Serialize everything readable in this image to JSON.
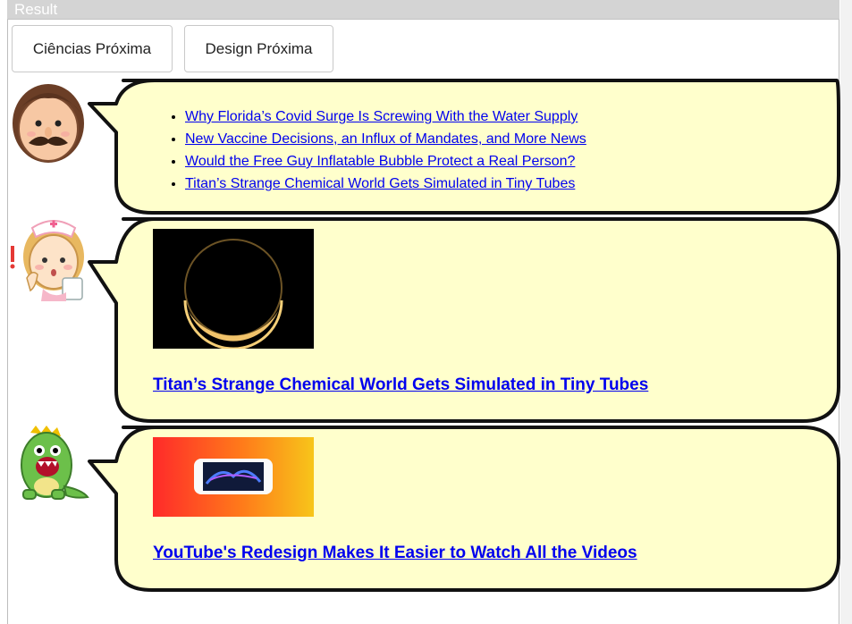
{
  "window": {
    "result_label": "Result"
  },
  "tabs": [
    {
      "label": "Ciências Próxima"
    },
    {
      "label": "Design Próxima"
    }
  ],
  "bubble1": {
    "links": [
      "Why Florida’s Covid Surge Is Screwing With the Water Supply",
      "New Vaccine Decisions, an Influx of Mandates, and More News",
      "Would the Free Guy Inflatable Bubble Protect a Real Person?",
      "Titan’s Strange Chemical World Gets Simulated in Tiny Tubes"
    ]
  },
  "bubble2": {
    "headline": "Titan’s Strange Chemical World Gets Simulated in Tiny Tubes"
  },
  "bubble3": {
    "headline": "YouTube's Redesign Makes It Easier to Watch All the Videos"
  },
  "colors": {
    "bubble_fill": "#ffffcc",
    "bubble_border": "#111111",
    "link": "#0000ee"
  },
  "icons": [
    "mustache-man-avatar-icon",
    "nurse-avatar-icon",
    "green-monster-avatar-icon"
  ]
}
